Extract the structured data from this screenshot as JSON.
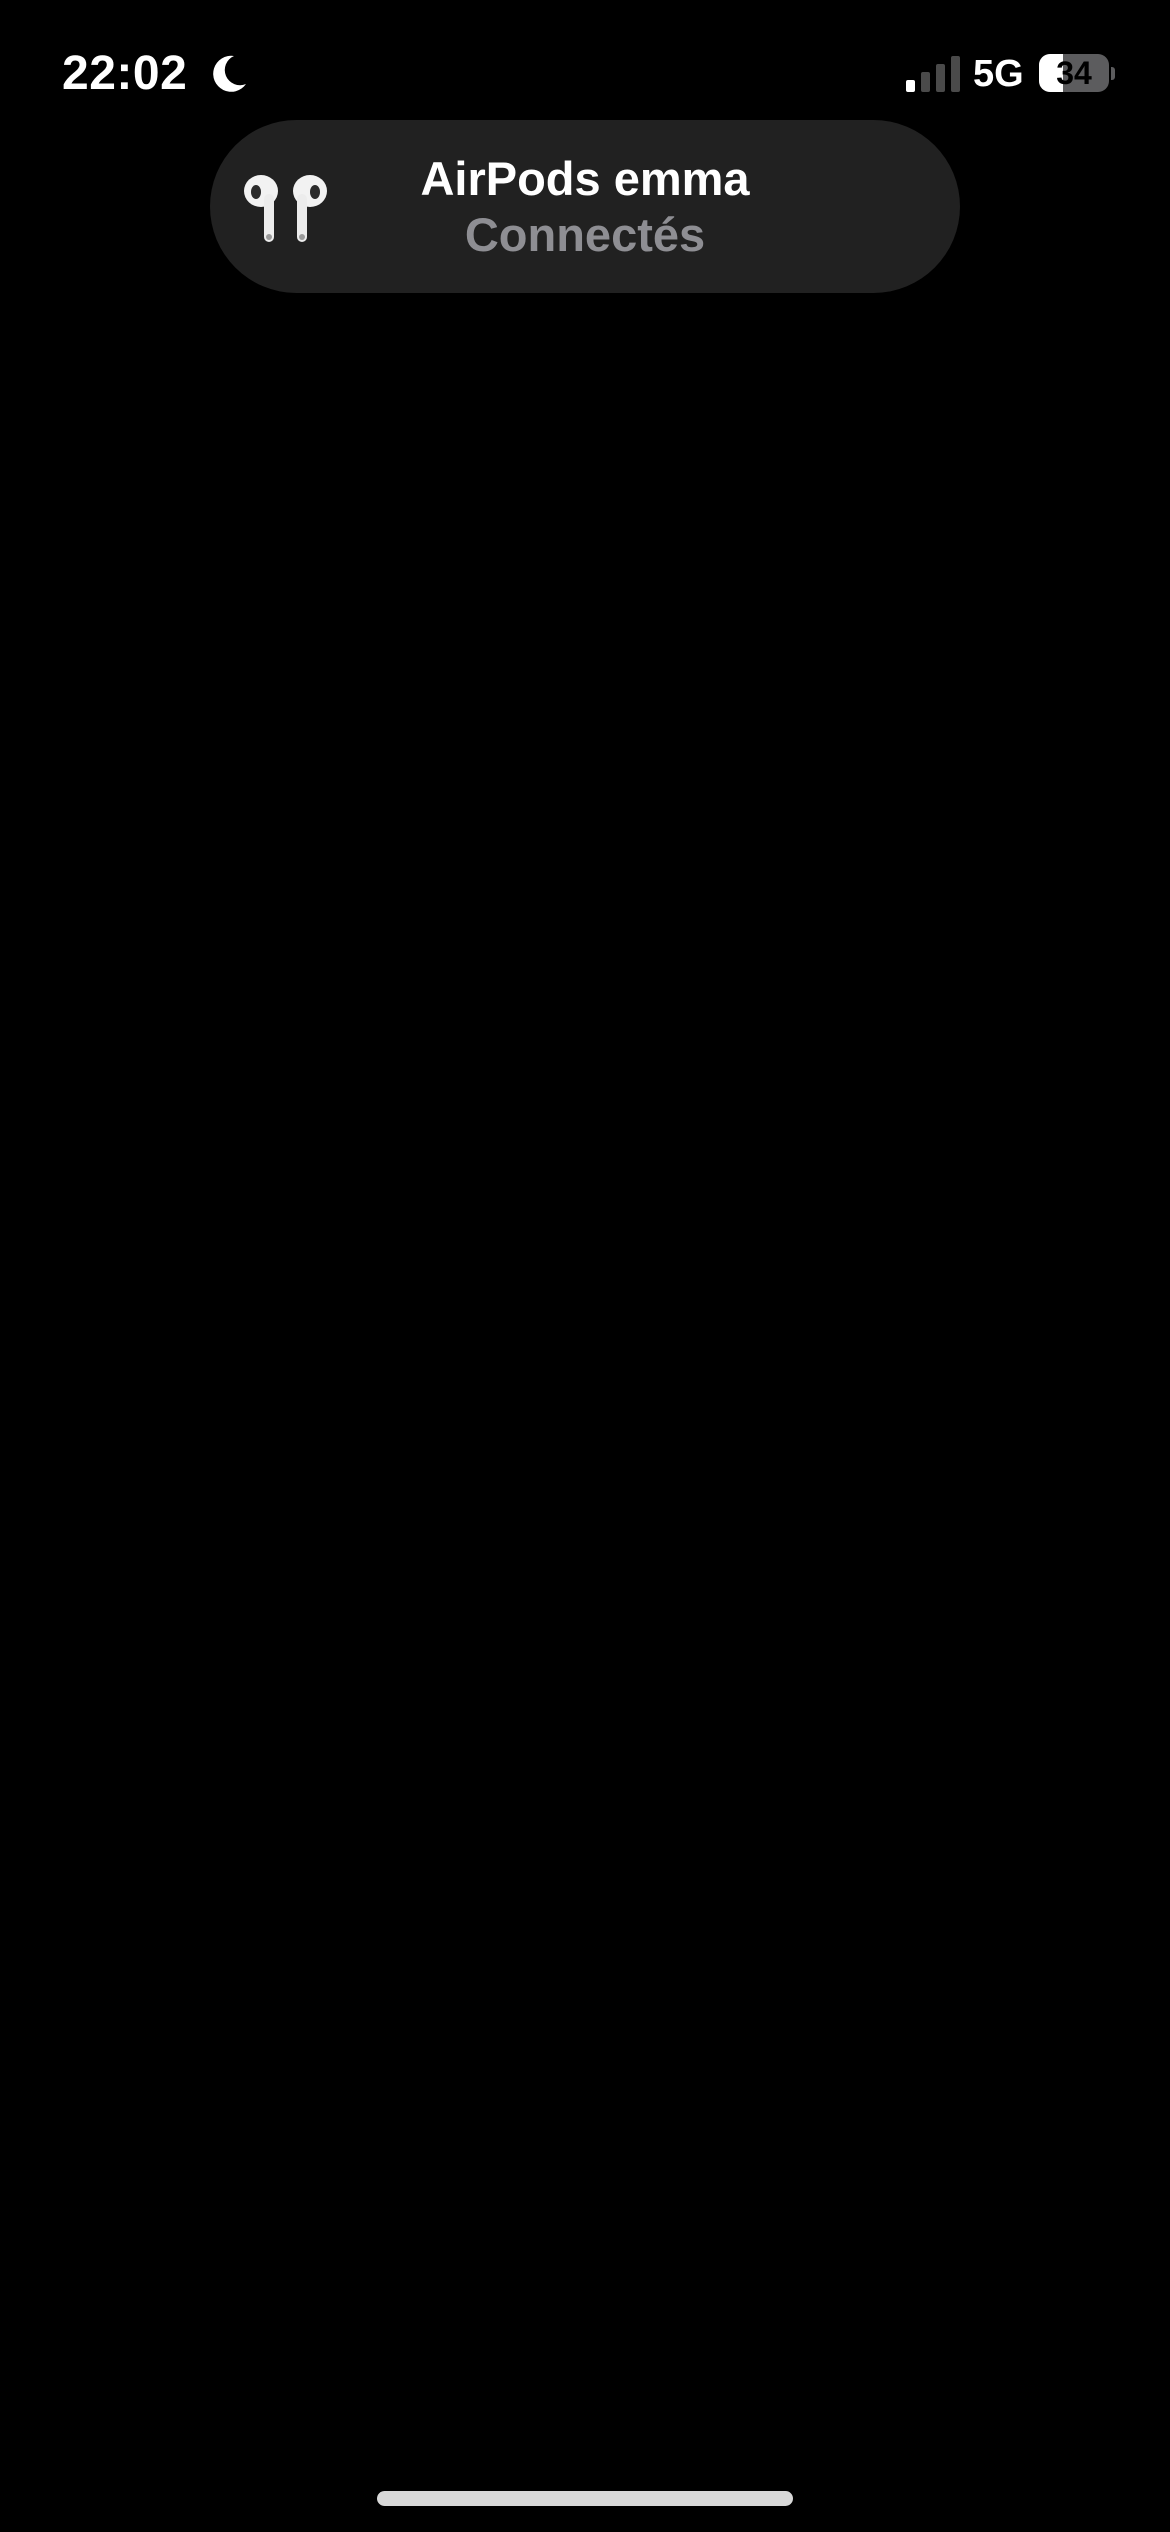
{
  "status_bar": {
    "time": "22:02",
    "network": "5G",
    "battery_level": "34",
    "battery_fraction": 0.34,
    "signal_bars_active": 1,
    "signal_bars_total": 4,
    "icons": [
      "moon-icon",
      "signal-icon",
      "battery-icon"
    ]
  },
  "notification": {
    "title": "AirPods emma",
    "status": "Connectés",
    "icon": "airpods-icon"
  },
  "colors": {
    "background": "#000000",
    "island": "#212121",
    "primary_text": "#ffffff",
    "secondary_text": "#8e8e93"
  }
}
